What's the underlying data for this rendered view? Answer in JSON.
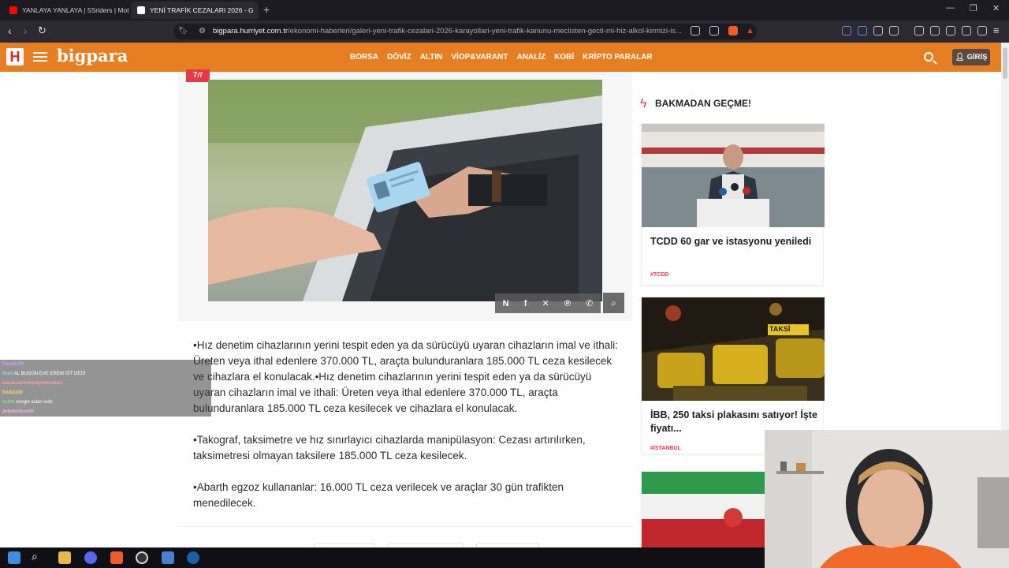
{
  "browser": {
    "tabs": [
      {
        "label": "YANLAYA YANLAYA | 5Sriders | Moto"
      },
      {
        "label": "YENİ TRAFİK CEZALARI 2026 - G"
      }
    ],
    "new_tab": "+",
    "url_domain": "bigpara.hurriyet.com.tr",
    "url_path": "/ekonomi-haberleri/galeri-yeni-trafik-cezalari-2026-karayollari-yeni-trafik-kanunu-meclisten-gecti-mi-hiz-alkol-kirmizi-is..."
  },
  "site": {
    "logo": "bigpara",
    "h_logo": "H",
    "nav": [
      "BORSA",
      "DÖVİZ",
      "ALTIN",
      "VİOP&VARANT",
      "ANALİZ",
      "KOBİ",
      "KRİPTO PARALAR"
    ],
    "login_label": "GİRİŞ"
  },
  "gallery": {
    "counter_current": "7",
    "counter_total": "/7",
    "zoom_icon": "zoom-icon"
  },
  "article": {
    "paragraphs": [
      "•Hız denetim cihazlarının yerini tespit eden ya da sürücüyü uyaran cihazların imal ve ithali: Üreten veya ithal edenlere 370.000 TL, araçta bulunduranlara 185.000 TL ceza kesilecek ve cihazlara el konulacak.•Hız denetim cihazlarının yerini tespit eden ya da sürücüyü uyaran cihazların imal ve ithali: Üreten veya ithal edenlere 370.000 TL, araçta bulunduranlara 185.000 TL ceza kesilecek ve cihazlara el konulacak.",
      "•Takograf, taksimetre ve hız sınırlayıcı cihazlarda manipülasyon: Cezası artırılırken, taksimetresi olmayan taksilere 185.000 TL ceza kesilecek.",
      "•Abarth egzoz kullananlar: 16.000 TL ceza verilecek ve araçlar 30 gün trafikten menedilecek."
    ]
  },
  "sidebar": {
    "title": "BAKMADAN GEÇME!",
    "cards": [
      {
        "title": "TCDD 60 gar ve istasyonu yeniledi",
        "tag": "#TCDD"
      },
      {
        "title": "İBB, 250 taksi plakasını satıyor! İşte fiyatı...",
        "tag": "#İSTANBUL"
      }
    ]
  },
  "chat": {
    "lines": [
      {
        "user": "PleadsTR",
        "text": ""
      },
      {
        "user": "Ruhi",
        "text": "AL BUGÜN EVE EREM GİT DEDİ"
      },
      {
        "user": "basaksehirmmdyetmuduru",
        "text": ""
      },
      {
        "user": "fredizz00",
        "text": ""
      },
      {
        "user": "selim",
        "text": "zengin aslan sufu"
      },
      {
        "user": "jwbukullcsmtr",
        "text": ""
      }
    ]
  },
  "photo_sign": "TAKSİ"
}
